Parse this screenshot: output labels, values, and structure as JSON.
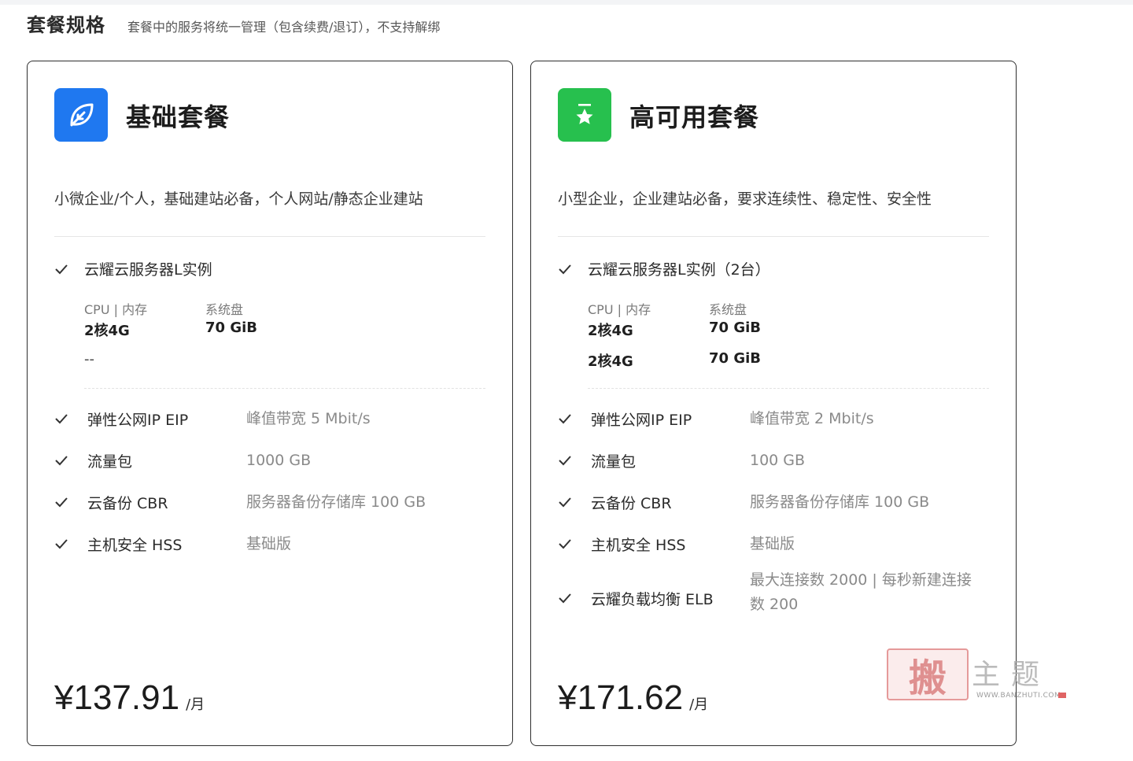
{
  "section": {
    "title": "套餐规格",
    "subtitle": "套餐中的服务将统一管理（包含续费/退订），不支持解绑"
  },
  "plans": [
    {
      "name": "基础套餐",
      "icon": "leaf-icon",
      "icon_color": "#1f78f0",
      "description": "小微企业/个人，基础建站必备，个人网站/静态企业建站",
      "instance_label": "云耀云服务器L实例",
      "spec_headers": {
        "cpu": "CPU | 内存",
        "disk": "系统盘"
      },
      "specs": [
        {
          "cpu": "2核4G",
          "disk": "70 GiB"
        }
      ],
      "spec_extra": "--",
      "features": [
        {
          "name": "弹性公网IP EIP",
          "value": "峰值带宽 5 Mbit/s"
        },
        {
          "name": "流量包",
          "value": "1000 GB"
        },
        {
          "name": "云备份 CBR",
          "value": "服务器备份存储库 100 GB"
        },
        {
          "name": "主机安全 HSS",
          "value": "基础版"
        }
      ],
      "price": "¥137.91",
      "price_unit": "/月"
    },
    {
      "name": "高可用套餐",
      "icon": "star-badge-icon",
      "icon_color": "#27c04e",
      "description": "小型企业，企业建站必备，要求连续性、稳定性、安全性",
      "instance_label": "云耀云服务器L实例（2台）",
      "spec_headers": {
        "cpu": "CPU | 内存",
        "disk": "系统盘"
      },
      "specs": [
        {
          "cpu": "2核4G",
          "disk": "70 GiB"
        },
        {
          "cpu": "2核4G",
          "disk": "70 GiB"
        }
      ],
      "features": [
        {
          "name": "弹性公网IP EIP",
          "value": "峰值带宽 2 Mbit/s"
        },
        {
          "name": "流量包",
          "value": "100 GB"
        },
        {
          "name": "云备份 CBR",
          "value": "服务器备份存储库 100 GB"
        },
        {
          "name": "主机安全 HSS",
          "value": "基础版"
        },
        {
          "name": "云耀负载均衡 ELB",
          "value_line1": "最大连接数 2000 | 每秒新建连接",
          "value_line2": "数 200"
        }
      ],
      "price": "¥171.62",
      "price_unit": "/月"
    }
  ],
  "watermark": {
    "stamp_char": "搬",
    "chars": "主题",
    "url": "WWW.BANZHUTI.COM"
  }
}
